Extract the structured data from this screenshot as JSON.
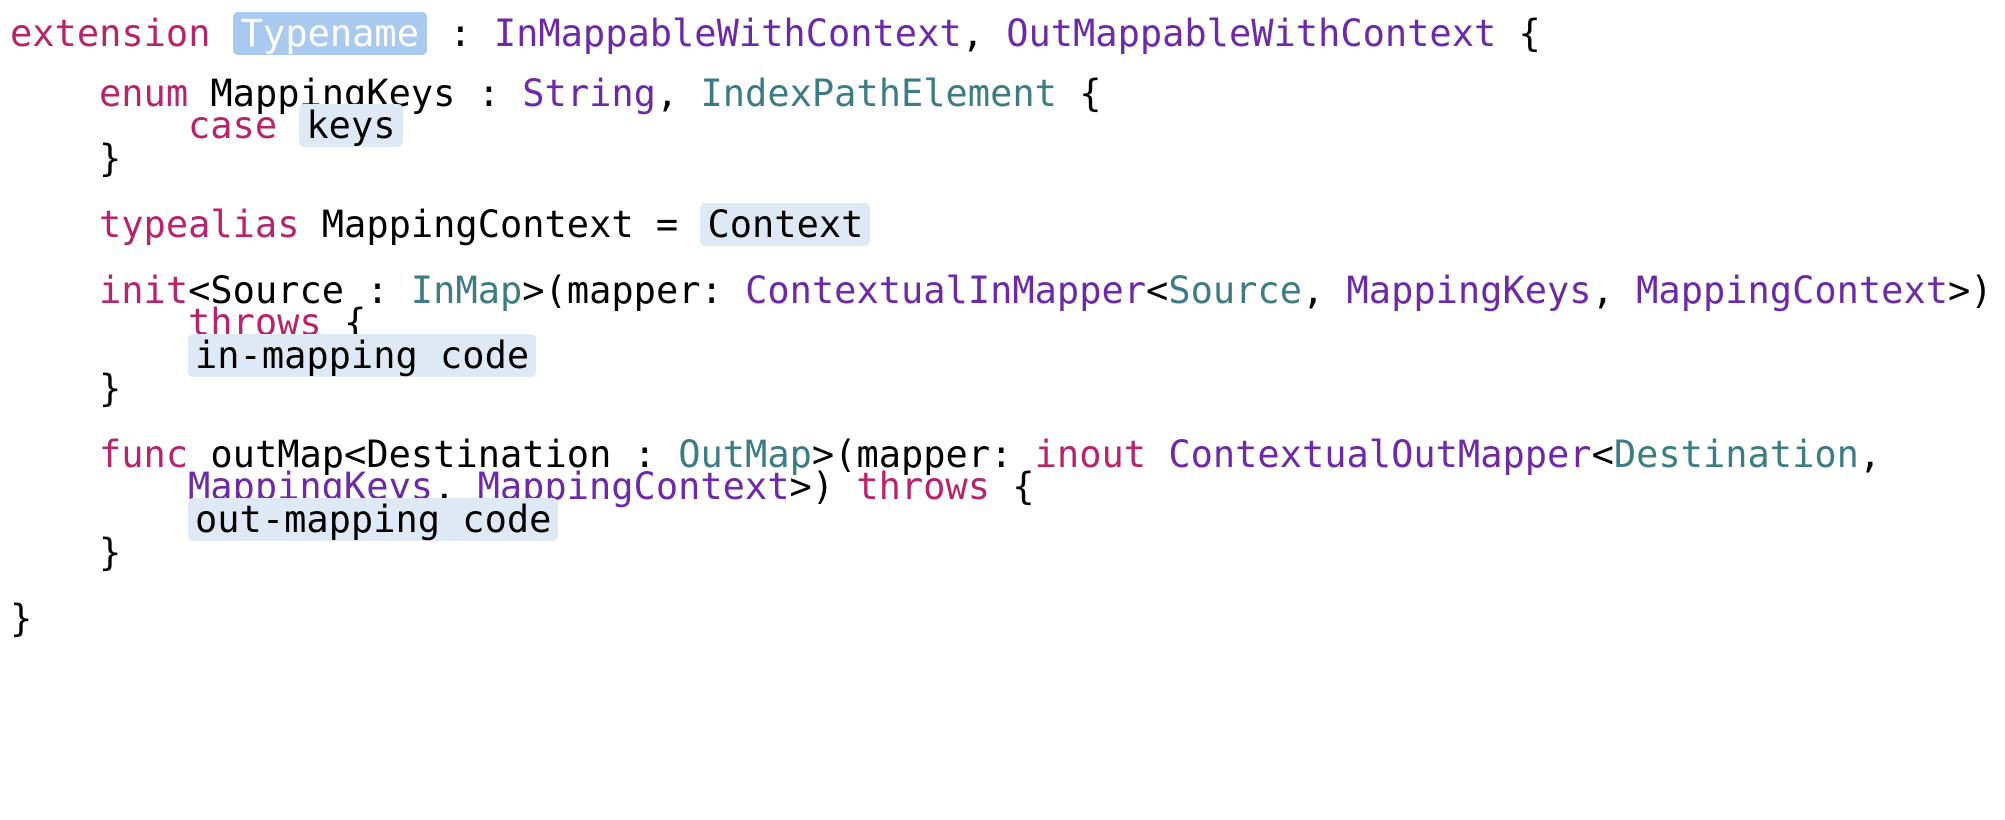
{
  "editor": {
    "l1": {
      "kw": "extension",
      "placeholder": "Typename",
      "colon": ":",
      "proto1": "InMappableWithContext",
      "comma": ",",
      "proto2": "OutMappableWithContext",
      "brace": "{"
    },
    "l2": {
      "kw": "enum",
      "name": "MappingKeys",
      "colon": ":",
      "t1": "String",
      "comma": ",",
      "t2": "IndexPathElement",
      "brace": "{"
    },
    "l3": {
      "kw": "case",
      "placeholder": "keys"
    },
    "l4": {
      "brace": "}"
    },
    "l5": {
      "kw": "typealias",
      "name": "MappingContext",
      "eq": "=",
      "placeholder": "Context"
    },
    "l6": {
      "kw": "init",
      "lt": "<",
      "gen": "Source",
      "colon": ":",
      "bound": "InMap",
      "open": ">(",
      "param": "mapper:",
      "type": "ContextualInMapper",
      "lt2": "<",
      "a1": "Source",
      "comma1": ",",
      "a2": "MappingKeys",
      "comma2": ",",
      "a3": "MappingContext",
      "close": ">)"
    },
    "l7": {
      "kw": "throws",
      "brace": "{"
    },
    "l8": {
      "placeholder": "in-mapping code"
    },
    "l9": {
      "brace": "}"
    },
    "l10": {
      "kw": "func",
      "name": "outMap",
      "lt": "<",
      "gen": "Destination",
      "colon": ":",
      "bound": "OutMap",
      "open": ">(",
      "param": "mapper:",
      "kw2": "inout",
      "type": "ContextualOutMapper",
      "lt2": "<",
      "a1": "Destination",
      "comma": ","
    },
    "l11": {
      "a2": "MappingKeys",
      "comma": ",",
      "a3": "MappingContext",
      "close": ">)",
      "kw": "throws",
      "brace": "{"
    },
    "l12": {
      "placeholder": "out-mapping code"
    },
    "l13": {
      "brace": "}"
    },
    "l14": {
      "brace": "}"
    }
  }
}
